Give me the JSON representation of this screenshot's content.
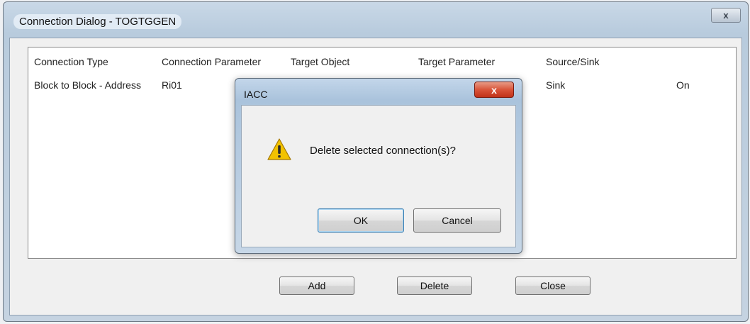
{
  "window": {
    "title": "Connection Dialog - TOGTGGEN",
    "close_glyph": "x"
  },
  "list": {
    "columns": [
      "Connection Type",
      "Connection Parameter",
      "Target Object",
      "Target Parameter",
      "Source/Sink",
      ""
    ],
    "rows": [
      [
        "Block to Block - Address",
        "Ri01",
        "",
        "",
        "Sink",
        "On"
      ]
    ]
  },
  "buttons": {
    "add": "Add",
    "delete": "Delete",
    "close": "Close"
  },
  "message_box": {
    "title": "IACC",
    "close_glyph": "x",
    "icon": "warning-icon",
    "text": "Delete selected connection(s)?",
    "ok": "OK",
    "cancel": "Cancel"
  },
  "colors": {
    "title_bar": "#b8cbdd",
    "close_red": "#d9543a",
    "warning_yellow": "#f2c200"
  }
}
